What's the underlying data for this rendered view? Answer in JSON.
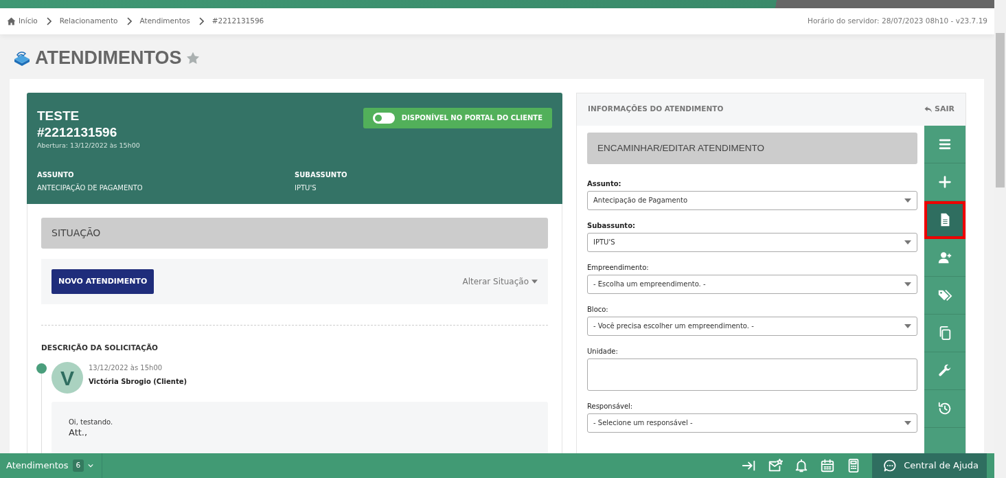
{
  "top_bar": {
    "breadcrumb": [
      {
        "label": "Início",
        "kind": "home"
      },
      {
        "label": "Relacionamento",
        "kind": "link"
      },
      {
        "label": "Atendimentos",
        "kind": "link"
      },
      {
        "label": "#2212131596",
        "kind": "current"
      }
    ],
    "server_info": "Horário do servidor: 28/07/2023 08h10 - v23.7.19"
  },
  "page_title": {
    "text": "ATENDIMENTOS",
    "favorite": false
  },
  "ticket": {
    "title": "TESTE",
    "number": "#2212131596",
    "opened": "Abertura: 13/12/2022 às 15h00",
    "portal_toggle": {
      "label": "DISPONÍVEL NO PORTAL DO CLIENTE",
      "on": false
    },
    "fields": [
      {
        "label": "ASSUNTO",
        "value": "ANTECIPAÇÃO DE PAGAMENTO"
      },
      {
        "label": "SUBASSUNTO",
        "value": "IPTU'S"
      }
    ]
  },
  "situation": {
    "title": "SITUAÇÃO",
    "primary_button": "NOVO ATENDIMENTO",
    "change_link": "Alterar Situação"
  },
  "description": {
    "title": "DESCRIÇÃO DA SOLICITAÇÃO",
    "entries": [
      {
        "avatar": "V",
        "date": "13/12/2022 às 15h00",
        "author": "Victória Sbrogio (Cliente)",
        "lines": [
          {
            "text": "Oi, testando.",
            "kind": "small"
          },
          {
            "text": "Att.,",
            "kind": "large"
          }
        ]
      }
    ]
  },
  "info_panel": {
    "title": "INFORMAÇÕES DO ATENDIMENTO",
    "exit": "SAIR",
    "section_title": "ENCAMINHAR/EDITAR ATENDIMENTO",
    "fields": [
      {
        "label": "Assunto:",
        "kind": "select",
        "value": "Antecipação de Pagamento",
        "required": true
      },
      {
        "label": "Subassunto:",
        "kind": "select",
        "value": "IPTU'S",
        "required": true
      },
      {
        "label": "Empreendimento:",
        "kind": "select",
        "value": "- Escolha um empreendimento. -",
        "required": false
      },
      {
        "label": "Bloco:",
        "kind": "select",
        "value": "- Você precisa escolher um empreendimento. -",
        "required": false
      },
      {
        "label": "Unidade:",
        "kind": "textarea",
        "required": false
      },
      {
        "label": "Responsável:",
        "kind": "select",
        "value": "- Selecione um responsável -",
        "required": false
      }
    ],
    "menu": [
      {
        "kind": "menu",
        "selected": false
      },
      {
        "kind": "plus",
        "selected": false
      },
      {
        "kind": "document",
        "selected": true
      },
      {
        "kind": "user-plus",
        "selected": false
      },
      {
        "kind": "tags",
        "selected": false
      },
      {
        "kind": "copy",
        "selected": false
      },
      {
        "kind": "wrench",
        "selected": false
      },
      {
        "kind": "history",
        "selected": false
      }
    ]
  },
  "bottom_bar": {
    "module": "Atendimentos",
    "count": "6",
    "tools": [
      {
        "kind": "collapse"
      },
      {
        "kind": "mail-star"
      },
      {
        "kind": "bell"
      },
      {
        "kind": "calendar"
      },
      {
        "kind": "calculator"
      }
    ],
    "help": "Central de Ajuda"
  }
}
